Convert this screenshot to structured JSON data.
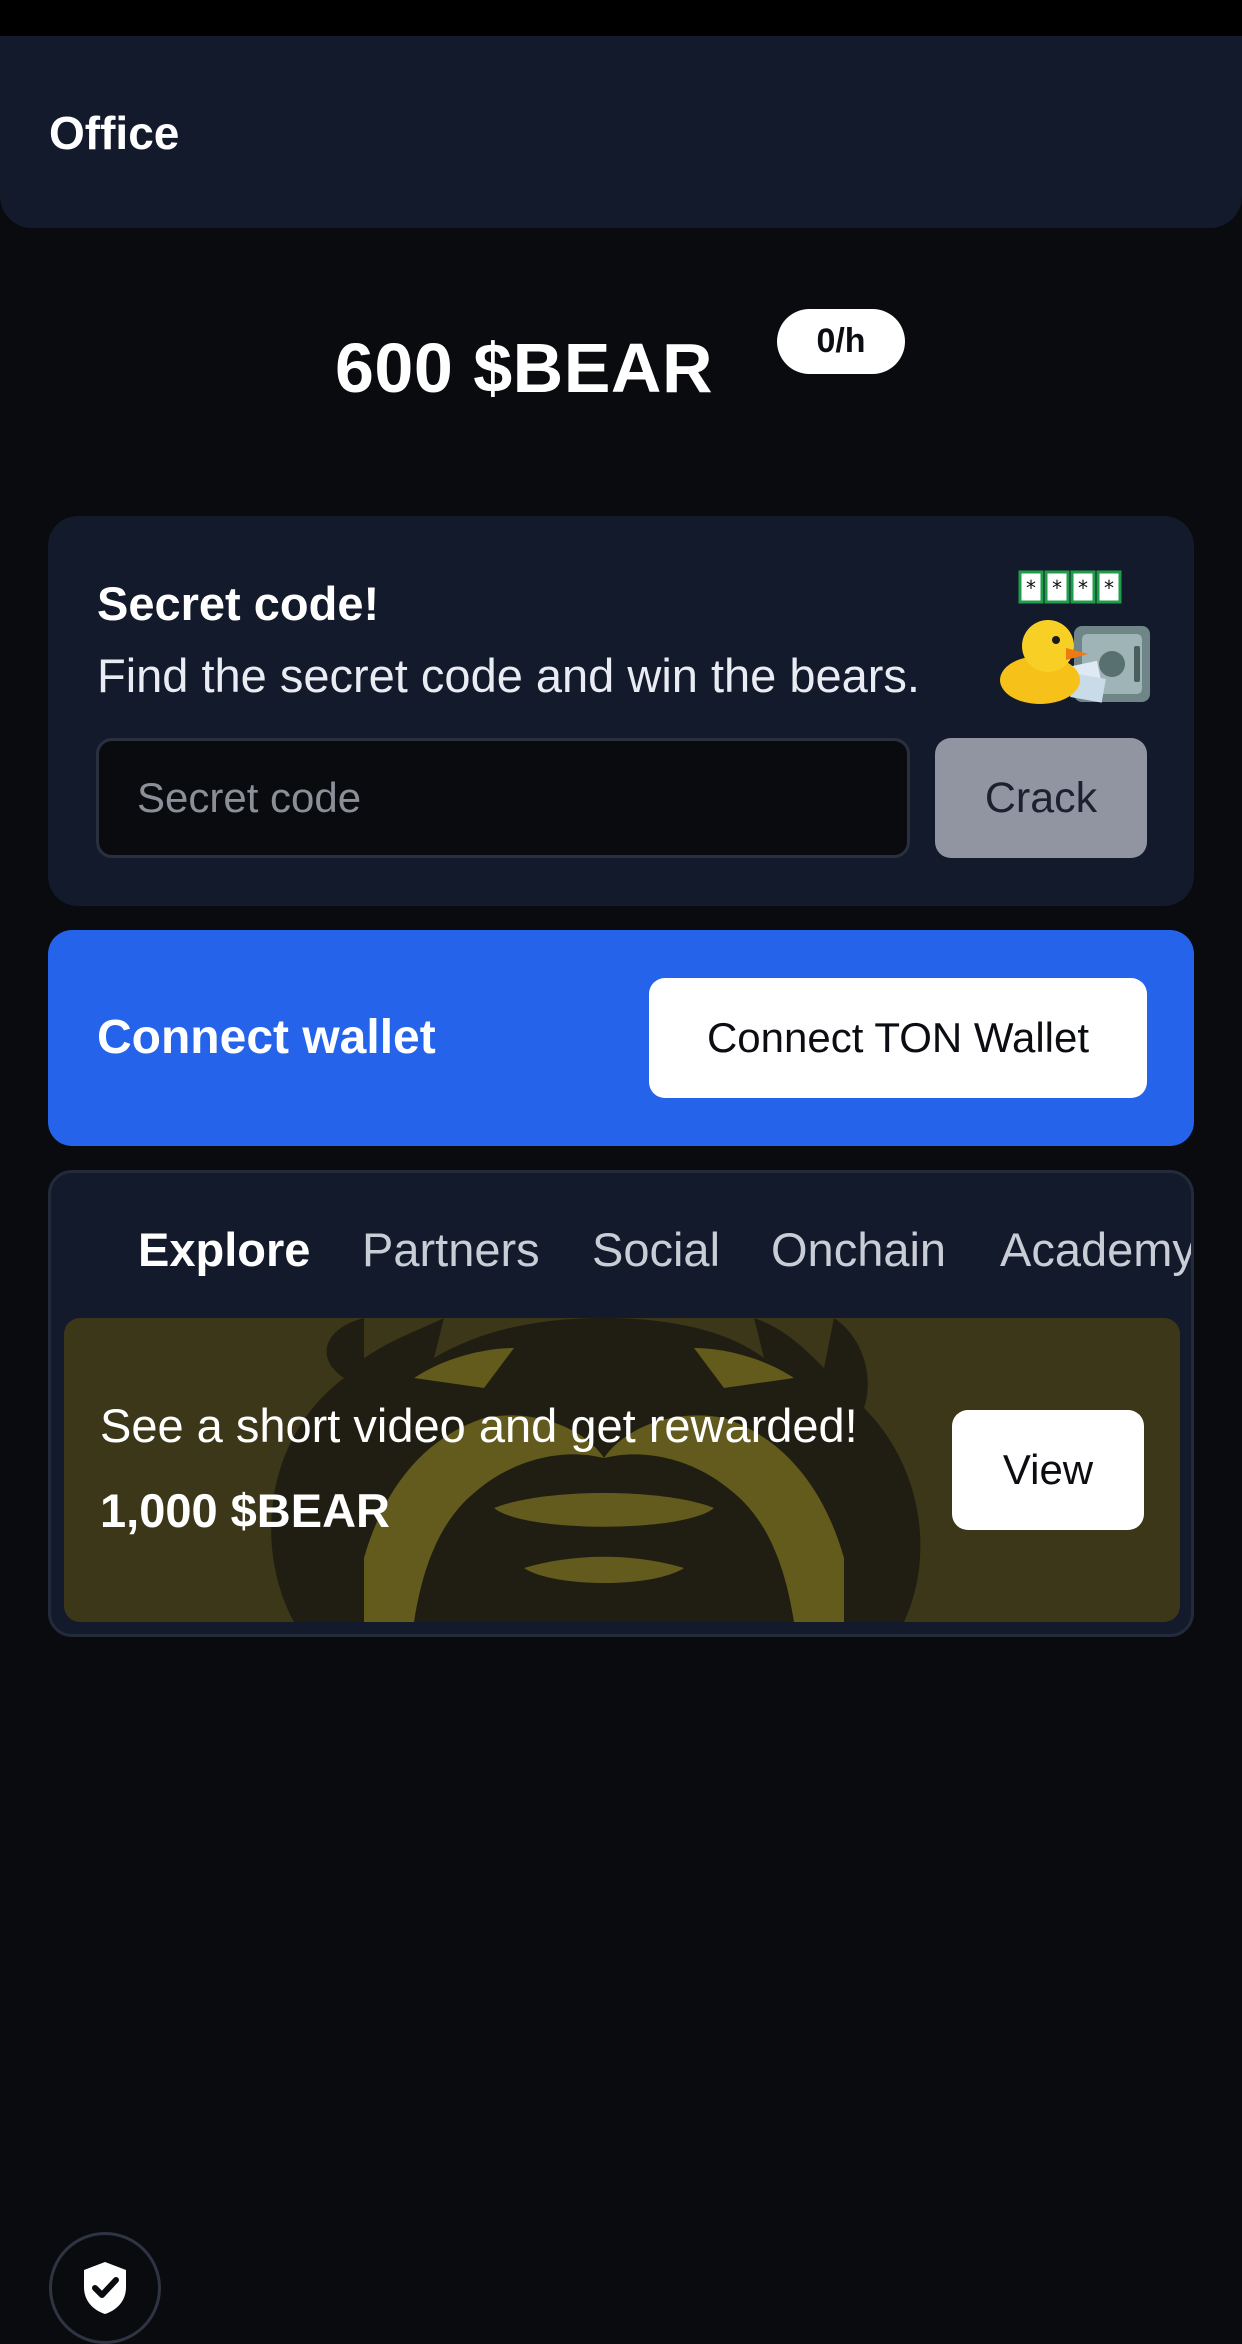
{
  "header": {
    "title": "Office"
  },
  "balance": {
    "amount": "600 $BEAR",
    "rate": "0/h"
  },
  "secret_code": {
    "title": "Secret code!",
    "description": "Find the secret code and win the bears.",
    "input_placeholder": "Secret code",
    "button_label": "Crack",
    "illustration_icon": "duck-safe-icon"
  },
  "wallet": {
    "title": "Connect wallet",
    "button_label": "Connect TON Wallet"
  },
  "tasks": {
    "tabs": [
      {
        "label": "Explore",
        "active": true
      },
      {
        "label": "Partners",
        "active": false
      },
      {
        "label": "Social",
        "active": false
      },
      {
        "label": "Onchain",
        "active": false
      },
      {
        "label": "Academy",
        "active": false
      }
    ],
    "items": [
      {
        "text": "See a short video and get rewarded!",
        "reward": "1,000 $BEAR",
        "button_label": "View"
      }
    ]
  },
  "footer": {
    "security_icon": "shield-check-icon"
  },
  "colors": {
    "background": "#0a0b0e",
    "card": "#131a2b",
    "accent_blue": "#2563eb",
    "task_banner": "#3b3718",
    "crack_button": "#9194a1"
  }
}
